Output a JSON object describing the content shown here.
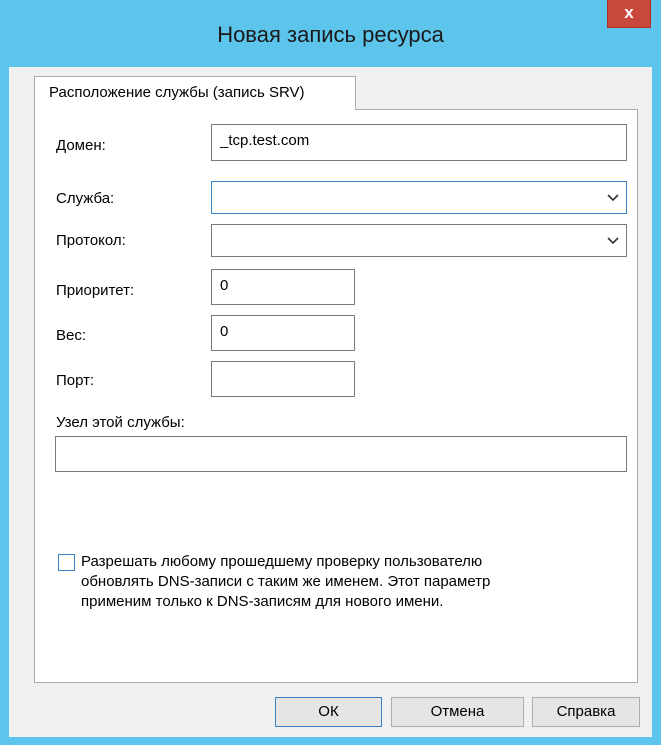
{
  "window": {
    "title": "Новая запись ресурса",
    "close_label": "x"
  },
  "tab": {
    "label": "Расположение службы (запись SRV)"
  },
  "form": {
    "domain_label": "Домен:",
    "domain_value": "_tcp.test.com",
    "service_label": "Служба:",
    "service_value": "",
    "protocol_label": "Протокол:",
    "protocol_value": "",
    "priority_label": "Приоритет:",
    "priority_value": "0",
    "weight_label": "Вес:",
    "weight_value": "0",
    "port_label": "Порт:",
    "port_value": "",
    "host_label": "Узел этой службы:",
    "host_value": "",
    "allow_update_checked": false,
    "allow_update_line1": "Разрешать любому прошедшему проверку пользователю",
    "allow_update_line2": "обновлять DNS-записи с таким же именем. Этот параметр",
    "allow_update_line3": "применим только к DNS-записям для нового имени."
  },
  "buttons": {
    "ok": "ОК",
    "cancel": "Отмена",
    "help": "Справка"
  },
  "colors": {
    "titlebar": "#5dc4ec",
    "close": "#c9483c",
    "focus": "#3a83c9"
  }
}
